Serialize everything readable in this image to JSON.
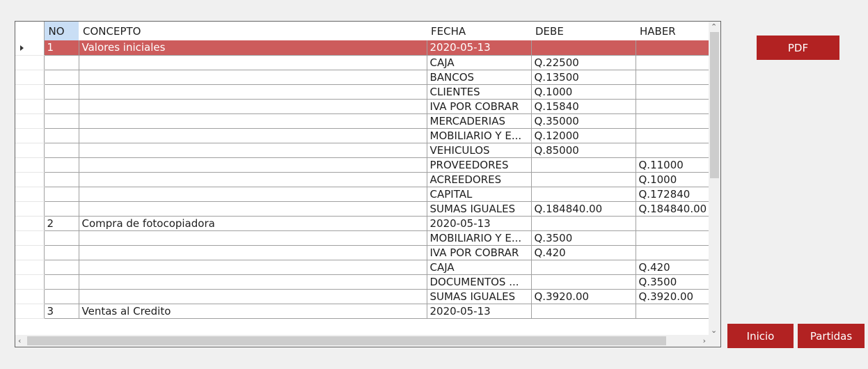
{
  "table": {
    "columns": [
      "NO",
      "CONCEPTO",
      "FECHA",
      "DEBE",
      "HABER"
    ],
    "rows": [
      [
        "1",
        "Valores iniciales",
        "2020-05-13",
        "",
        ""
      ],
      [
        "",
        "",
        "CAJA",
        "Q.22500",
        ""
      ],
      [
        "",
        "",
        "BANCOS",
        "Q.13500",
        ""
      ],
      [
        "",
        "",
        "CLIENTES",
        "Q.1000",
        ""
      ],
      [
        "",
        "",
        "IVA POR COBRAR",
        "Q.15840",
        ""
      ],
      [
        "",
        "",
        "MERCADERIAS",
        "Q.35000",
        ""
      ],
      [
        "",
        "",
        "MOBILIARIO Y E...",
        "Q.12000",
        ""
      ],
      [
        "",
        "",
        "VEHICULOS",
        "Q.85000",
        ""
      ],
      [
        "",
        "",
        "PROVEEDORES",
        "",
        "Q.11000"
      ],
      [
        "",
        "",
        "ACREEDORES",
        "",
        "Q.1000"
      ],
      [
        "",
        "",
        "CAPITAL",
        "",
        "Q.172840"
      ],
      [
        "",
        "",
        "SUMAS IGUALES",
        "Q.184840.00",
        "Q.184840.00"
      ],
      [
        "2",
        "Compra de fotocopiadora",
        "2020-05-13",
        "",
        ""
      ],
      [
        "",
        "",
        "MOBILIARIO Y E...",
        "Q.3500",
        ""
      ],
      [
        "",
        "",
        "IVA POR COBRAR",
        "Q.420",
        ""
      ],
      [
        "",
        "",
        "CAJA",
        "",
        "Q.420"
      ],
      [
        "",
        "",
        "DOCUMENTOS ...",
        "",
        "Q.3500"
      ],
      [
        "",
        "",
        "SUMAS IGUALES",
        "Q.3920.00",
        "Q.3920.00"
      ],
      [
        "3",
        "Ventas al Credito",
        "2020-05-13",
        "",
        ""
      ]
    ]
  },
  "buttons": {
    "pdf": "PDF",
    "inicio": "Inicio",
    "partidas": "Partidas"
  },
  "colors": {
    "selected_row": "#cd5c5c",
    "button": "#b22222",
    "header_selected": "#c9def5"
  }
}
